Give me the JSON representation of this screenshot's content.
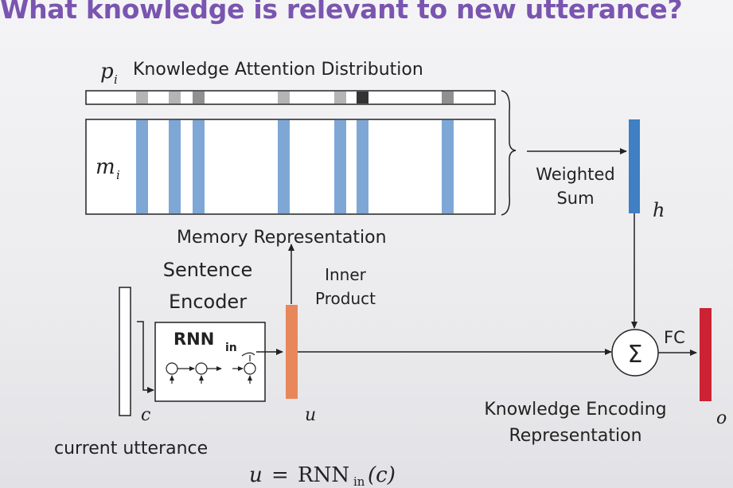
{
  "title": "What knowledge is relevant to new utterance?",
  "labels": {
    "p_var": "p",
    "p_sub": "i",
    "attention": "Knowledge Attention Distribution",
    "m_var": "m",
    "m_sub": "i",
    "weighted_line1": "Weighted",
    "weighted_line2": "Sum",
    "h_var": "h",
    "memory_rep": "Memory Representation",
    "sentence_line1": "Sentence",
    "sentence_line2": "Encoder",
    "inner_line1": "Inner",
    "inner_line2": "Product",
    "rnn_main": "RNN",
    "rnn_sub": "in",
    "c_var": "c",
    "u_var": "u",
    "sigma": "Σ",
    "fc": "FC",
    "o_var": "o",
    "kenc_line1": "Knowledge Encoding",
    "kenc_line2": "Representation",
    "current_utterance": "current utterance",
    "formula_u": "u",
    "formula_eq": "=",
    "formula_rnn": "RNN",
    "formula_in": "in",
    "formula_arg": "(c)"
  },
  "colors": {
    "title": "#7a55b0",
    "memory_slot": "#7ea7d6",
    "h_vector": "#3f7fc4",
    "u_vector": "#e8875a",
    "o_vector": "#cc2233",
    "attention_light": "#b4b4b4",
    "attention_mid": "#909090",
    "attention_dark": "#333333"
  },
  "attention_cells": [
    {
      "shade": "light"
    },
    {
      "shade": "light"
    },
    {
      "shade": "mid"
    },
    {
      "shade": "light"
    },
    {
      "shade": "light"
    },
    {
      "shade": "dark"
    },
    {
      "shade": "mid"
    }
  ]
}
